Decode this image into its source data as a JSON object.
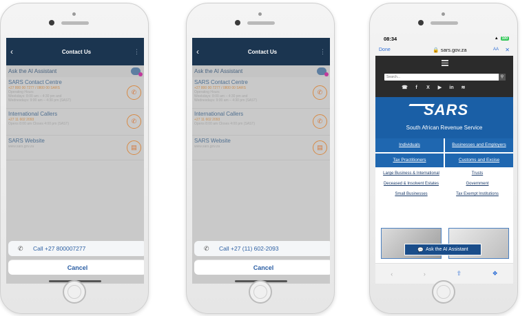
{
  "contact": {
    "title": "Contact Us",
    "ai_assistant": "Ask the AI Assistant",
    "items": [
      {
        "title": "SARS Contact Centre",
        "phone": "+27 800 00 7277 / 0800 00 SARS",
        "lines": [
          "Operating Hours",
          "Weekdays: 8:00 am – 4:30 pm and",
          "Wednesdays: 9:00 am – 4:30 pm (SAST)"
        ]
      },
      {
        "title": "International Callers",
        "phone": "+27 11 602 2093",
        "lines": [
          "Opens 8:00 am Closes 4:00 pm (SAST)"
        ]
      },
      {
        "title": "SARS Website",
        "phone": "",
        "lines": [
          "www.sars.gov.za"
        ]
      }
    ]
  },
  "phone1": {
    "call_label": "Call +27 800007277",
    "cancel_label": "Cancel"
  },
  "phone2": {
    "call_label": "Call +27 (11) 602-2093",
    "cancel_label": "Cancel"
  },
  "browser": {
    "time": "08:34",
    "battery": "100",
    "done_label": "Done",
    "url": "sars.gov.za",
    "aa_label": "AA",
    "search_placeholder": "Search...",
    "logo_text": "SARS",
    "org_name": "South African Revenue Service",
    "nav": [
      "Individuals",
      "Businesses and Employers",
      "Tax Practitioners",
      "Customs and Excise"
    ],
    "links": [
      "Large Business & International",
      "Trusts",
      "Deceased & Insolvent Estates",
      "Government",
      "Small Businesses",
      "Tax Exempt Institutions"
    ],
    "ai_button": "Ask the AI Assistant"
  }
}
